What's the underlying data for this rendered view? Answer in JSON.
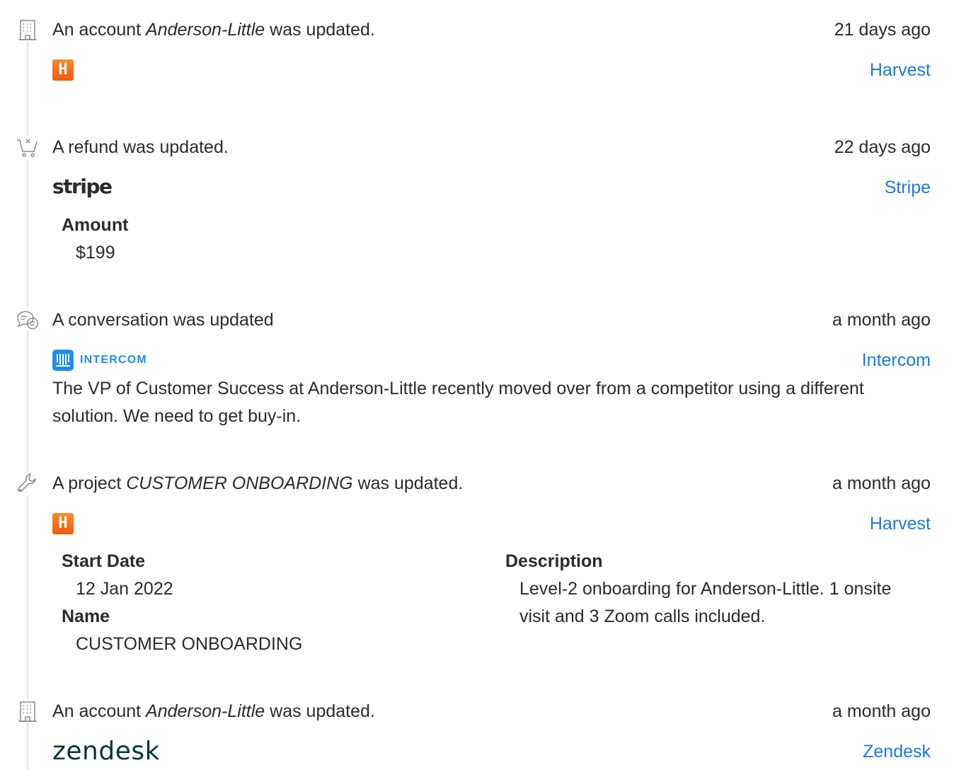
{
  "events": [
    {
      "icon": "building-icon",
      "title_prefix": "An account ",
      "title_em": "Anderson-Little",
      "title_suffix": " was updated.",
      "time": "21 days ago",
      "source": "Harvest",
      "source_logo_text": "H"
    },
    {
      "icon": "cart-refund-icon",
      "title": "A refund was updated.",
      "time": "22 days ago",
      "source": "Stripe",
      "source_logo_text": "stripe",
      "fields": [
        {
          "label": "Amount",
          "value": "$199"
        }
      ]
    },
    {
      "icon": "chat-bubbles-icon",
      "title": "A conversation was updated",
      "time": "a month ago",
      "source": "Intercom",
      "source_logo_text": "INTERCOM",
      "body": "The VP of Customer Success at Anderson-Little recently moved over from a competitor using a different solution. We need to get buy-in."
    },
    {
      "icon": "wrench-icon",
      "title_prefix": "A project ",
      "title_em": "CUSTOMER ONBOARDING",
      "title_suffix": " was updated.",
      "time": "a month ago",
      "source": "Harvest",
      "source_logo_text": "H",
      "fields": [
        {
          "label": "Start Date",
          "value": "12 Jan 2022"
        },
        {
          "label": "Name",
          "value": "CUSTOMER ONBOARDING"
        },
        {
          "label": "Description",
          "value": "Level-2 onboarding for Anderson-Little. 1 onsite visit and 3 Zoom calls included."
        }
      ]
    },
    {
      "icon": "building-icon",
      "title_prefix": "An account ",
      "title_em": "Anderson-Little",
      "title_suffix": " was updated.",
      "time": "a month ago",
      "source": "Zendesk",
      "source_logo_text": "zendesk"
    }
  ],
  "colors": {
    "link": "#1a7be0",
    "text": "#2b2b2b",
    "icon": "#8a8a8a",
    "timeline": "#e2e2e2",
    "harvest": "#f5731c",
    "intercom": "#1f8ded",
    "zendesk": "#03363d"
  }
}
